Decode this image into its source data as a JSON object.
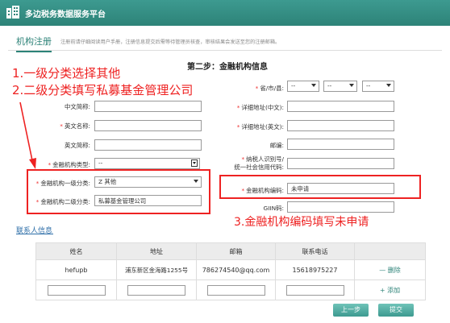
{
  "header": {
    "title": "多边税务数据服务平台"
  },
  "tab": {
    "label": "机构注册"
  },
  "notice": "注册前请仔细阅读用户手册，注册信息提交后需等待管理员核查，审核结果会发送至您的注册邮箱。",
  "step_title": "第二步：金融机构信息",
  "fields": {
    "cn_abbr": {
      "label": "中文简称:"
    },
    "en_name": {
      "label": "英文名称:"
    },
    "en_abbr": {
      "label": "英文简称:"
    },
    "inst_type": {
      "label": "金融机构类型:",
      "value": "--"
    },
    "level1": {
      "label": "金融机构一级分类:",
      "value": "Z 其他"
    },
    "level2": {
      "label": "金融机构二级分类:",
      "value": "私募基金管理公司"
    },
    "region": {
      "label": "省/市/县:",
      "sel1": "--",
      "sel2": "--",
      "sel3": "--"
    },
    "addr_cn": {
      "label": "详细地址(中文):"
    },
    "addr_en": {
      "label": "详细地址(英文):"
    },
    "postcode": {
      "label": "邮编:"
    },
    "tax_id": {
      "label_line1": "纳税人识别号/",
      "label_line2": "统一社会信用代码:"
    },
    "inst_code": {
      "label": "金融机构编码:",
      "value": "未申请"
    },
    "giin": {
      "label": "GIIN码:"
    }
  },
  "annotations": {
    "a1": "1.一级分类选择其他",
    "a2": "2.二级分类填写私募基金管理公司",
    "a3": "3.金融机构编码填写未申请"
  },
  "contacts": {
    "link": "联系人信息",
    "columns": [
      "姓名",
      "地址",
      "邮箱",
      "联系电话"
    ],
    "rows": [
      {
        "name": "hefupb",
        "address": "浦东新区金海路1255号",
        "email": "786274540@qq.com",
        "phone": "15618975227",
        "action": "— 删除"
      }
    ],
    "add_action": "+ 添加"
  },
  "buttons": {
    "prev": "上一步",
    "submit": "提交"
  }
}
